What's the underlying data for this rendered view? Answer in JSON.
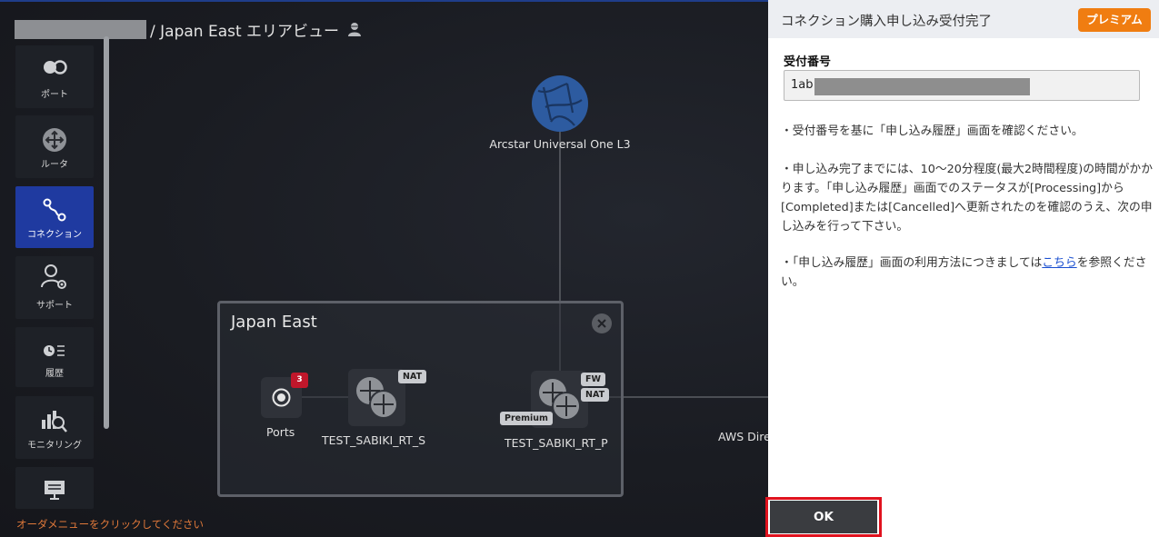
{
  "header": {
    "breadcrumb_suffix": "/ Japan East エリアビュー",
    "user_icon": "person-icon"
  },
  "sidebar": {
    "items": [
      {
        "label": "ポート",
        "icon": "port-icon"
      },
      {
        "label": "ルータ",
        "icon": "router-icon"
      },
      {
        "label": "コネクション",
        "icon": "connection-icon"
      },
      {
        "label": "サポート",
        "icon": "support-icon"
      },
      {
        "label": "履歴",
        "icon": "history-icon"
      },
      {
        "label": "モニタリング",
        "icon": "monitoring-icon"
      },
      {
        "label": "",
        "icon": "order-menu-icon"
      }
    ],
    "hint": "オーダメニューをクリックしてください"
  },
  "topology": {
    "cloud_label": "Arcstar Universal One L3",
    "region_title": "Japan East",
    "ports_label": "Ports",
    "ports_badge": "3",
    "router_s_label": "TEST_SABIKI_RT_S",
    "router_s_tag": "NAT",
    "router_p_label": "TEST_SABIKI_RT_P",
    "router_p_tags": [
      "FW",
      "NAT"
    ],
    "router_p_premium": "Premium",
    "aws_label": "AWS Dire"
  },
  "panel": {
    "title": "コネクション購入申し込み受付完了",
    "premium_button": "プレミアム",
    "field_label": "受付番号",
    "field_value_visible": "1ab",
    "para1": "・受付番号を基に「申し込み履歴」画面を確認ください。",
    "para2": "・申し込み完了までには、10～20分程度(最大2時間程度)の時間がかかります。「申し込み履歴」画面でのステータスが[Processing]から[Completed]または[Cancelled]へ更新されたのを確認のうえ、次の申し込みを行って下さい。",
    "para3_before": "・「申し込み履歴」画面の利用方法につきましては",
    "para3_link": "こちら",
    "para3_after": "を参照ください。",
    "ok_button": "OK"
  }
}
